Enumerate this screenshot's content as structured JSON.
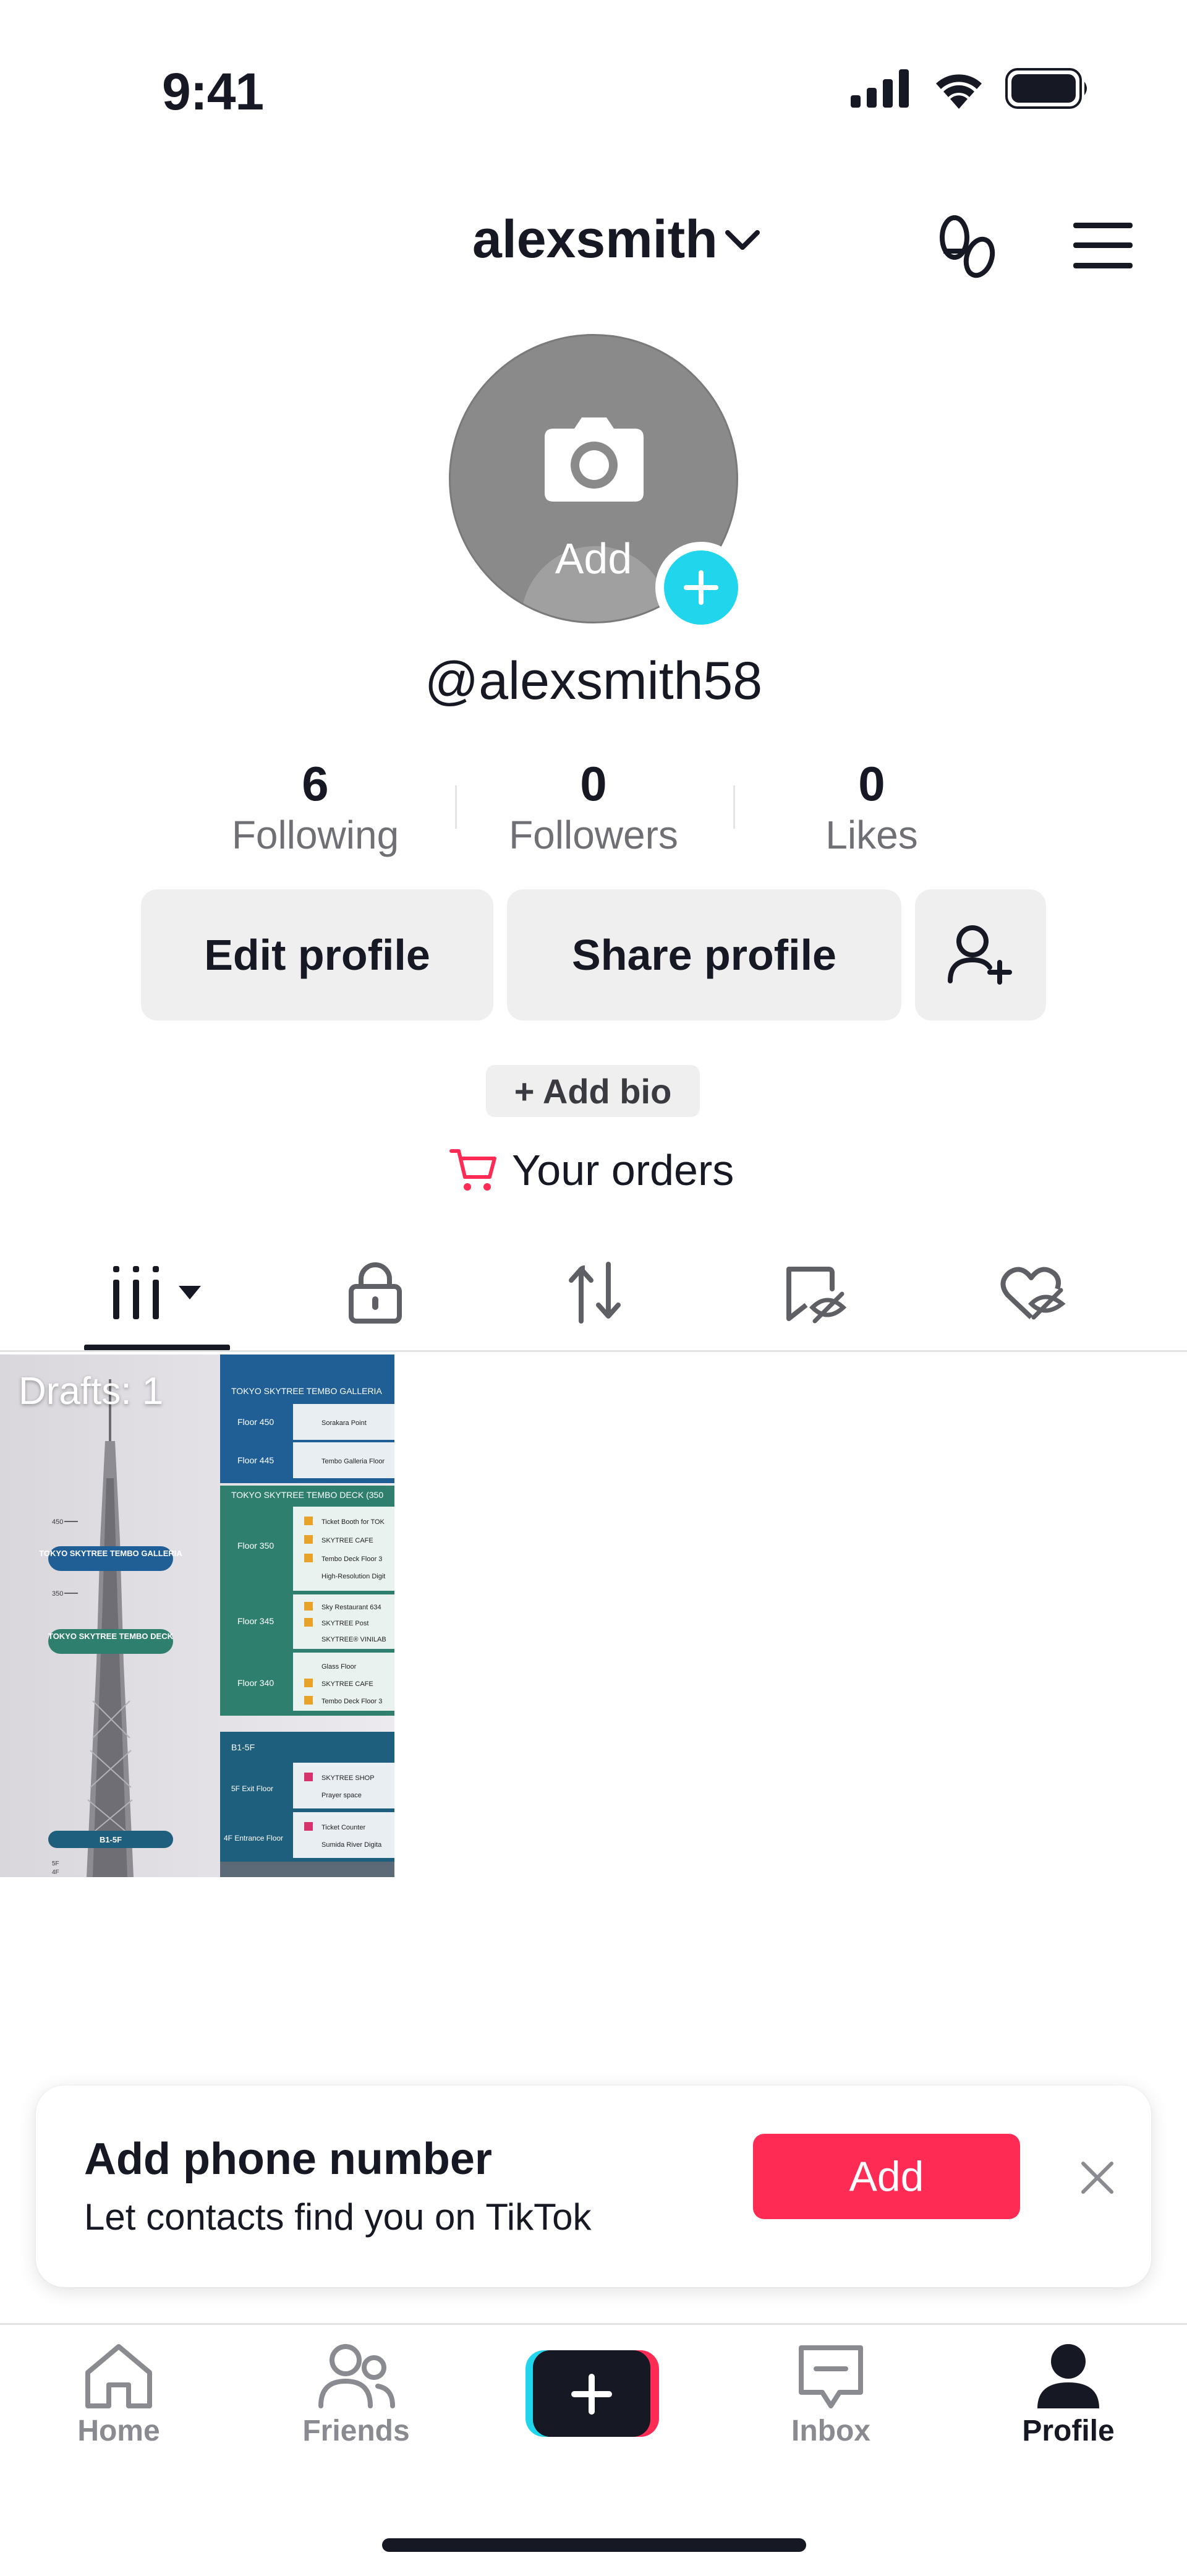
{
  "status_bar": {
    "time": "9:41"
  },
  "header": {
    "username": "alexsmith"
  },
  "profile": {
    "avatar_add_label": "Add",
    "handle": "@alexsmith58",
    "stats": [
      {
        "value": "6",
        "label": "Following"
      },
      {
        "value": "0",
        "label": "Followers"
      },
      {
        "value": "0",
        "label": "Likes"
      }
    ],
    "edit_profile": "Edit profile",
    "share_profile": "Share profile",
    "add_bio": "+ Add bio",
    "your_orders": "Your orders"
  },
  "grid": {
    "drafts_label": "Drafts: 1"
  },
  "drafts_thumbnail": {
    "top_header": "TOKYO SKYTREE TEMBO GALLERIA",
    "floor_450": "Floor 450",
    "floor_445": "Floor 445",
    "item_450": "Sorakara Point",
    "item_445": "Tembo Galleria Floor",
    "deck_header": "TOKYO SKYTREE TEMBO DECK (350",
    "floor_350": "Floor 350",
    "floor_345": "Floor 345",
    "floor_340": "Floor 340",
    "deck_items_350": [
      "Ticket Booth for TOK",
      "SKYTREE CAFE",
      "Tembo Deck Floor 3",
      "High-Resolution Digit"
    ],
    "deck_items_345": [
      "Sky Restaurant 634",
      "SKYTREE Post",
      "SKYTREE® VINILAB"
    ],
    "deck_items_340": [
      "Glass Floor",
      "SKYTREE CAFE",
      "Tembo Deck Floor 3"
    ],
    "b1_header": "B1-5F",
    "exit_floor": "5F Exit Floor",
    "entrance_floor": "4F Entrance Floor",
    "b1_items": [
      "SKYTREE SHOP",
      "Prayer space",
      "Ticket Counter",
      "Sumida River Digita"
    ],
    "tower_galleria": "TOKYO SKYTREE TEMBO GALLERIA",
    "tower_deck": "TOKYO SKYTREE TEMBO DECK",
    "tower_b1": "B1-5F",
    "tick_450": "450",
    "tick_350": "350",
    "tick_5f": "5F",
    "tick_4f": "4F"
  },
  "banner": {
    "title": "Add phone number",
    "subtitle": "Let contacts find you on TikTok",
    "add_button": "Add"
  },
  "nav": {
    "home": "Home",
    "friends": "Friends",
    "inbox": "Inbox",
    "profile": "Profile"
  },
  "colors": {
    "accent_red": "#fe2c55",
    "accent_cyan": "#20d5ec",
    "text_dark": "#161823"
  }
}
